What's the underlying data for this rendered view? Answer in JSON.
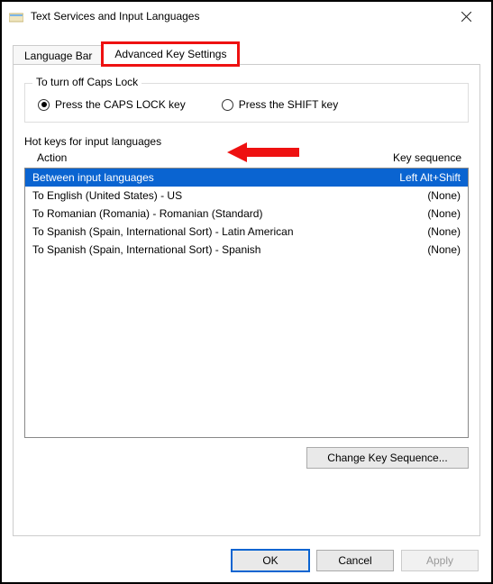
{
  "window": {
    "title": "Text Services and Input Languages"
  },
  "tabs": {
    "language_bar": "Language Bar",
    "advanced_key_settings": "Advanced Key Settings"
  },
  "capslock_group": {
    "legend": "To turn off Caps Lock",
    "option_capslock": "Press the CAPS LOCK key",
    "option_shift": "Press the SHIFT key"
  },
  "hotkeys": {
    "section_label": "Hot keys for input languages",
    "col_action": "Action",
    "col_keyseq": "Key sequence",
    "rows": [
      {
        "action": "Between input languages",
        "keyseq": "Left Alt+Shift",
        "selected": true
      },
      {
        "action": "To English (United States) - US",
        "keyseq": "(None)",
        "selected": false
      },
      {
        "action": "To Romanian (Romania) - Romanian (Standard)",
        "keyseq": "(None)",
        "selected": false
      },
      {
        "action": "To Spanish (Spain, International Sort) - Latin American",
        "keyseq": "(None)",
        "selected": false
      },
      {
        "action": "To Spanish (Spain, International Sort) - Spanish",
        "keyseq": "(None)",
        "selected": false
      }
    ],
    "change_btn": "Change Key Sequence..."
  },
  "buttons": {
    "ok": "OK",
    "cancel": "Cancel",
    "apply": "Apply"
  }
}
